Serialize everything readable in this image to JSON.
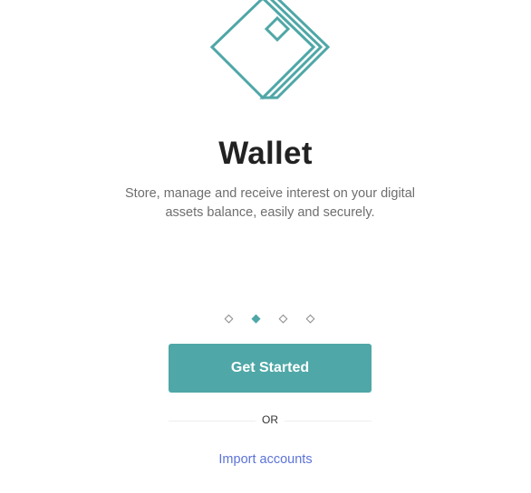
{
  "illustration": {
    "icon": "wallet-cards-icon",
    "color": "#4fa7a7"
  },
  "onboarding": {
    "title": "Wallet",
    "description": "Store, manage and receive interest on your digital assets balance, easily and securely."
  },
  "pagination": {
    "total": 4,
    "active_index": 1,
    "active_color": "#4fa7a7"
  },
  "actions": {
    "get_started_label": "Get Started",
    "divider_label": "OR",
    "import_label": "Import accounts"
  },
  "colors": {
    "accent": "#4fa7a7",
    "link": "#5b73d8",
    "title": "#222222",
    "body_text": "#6e6e6e"
  }
}
